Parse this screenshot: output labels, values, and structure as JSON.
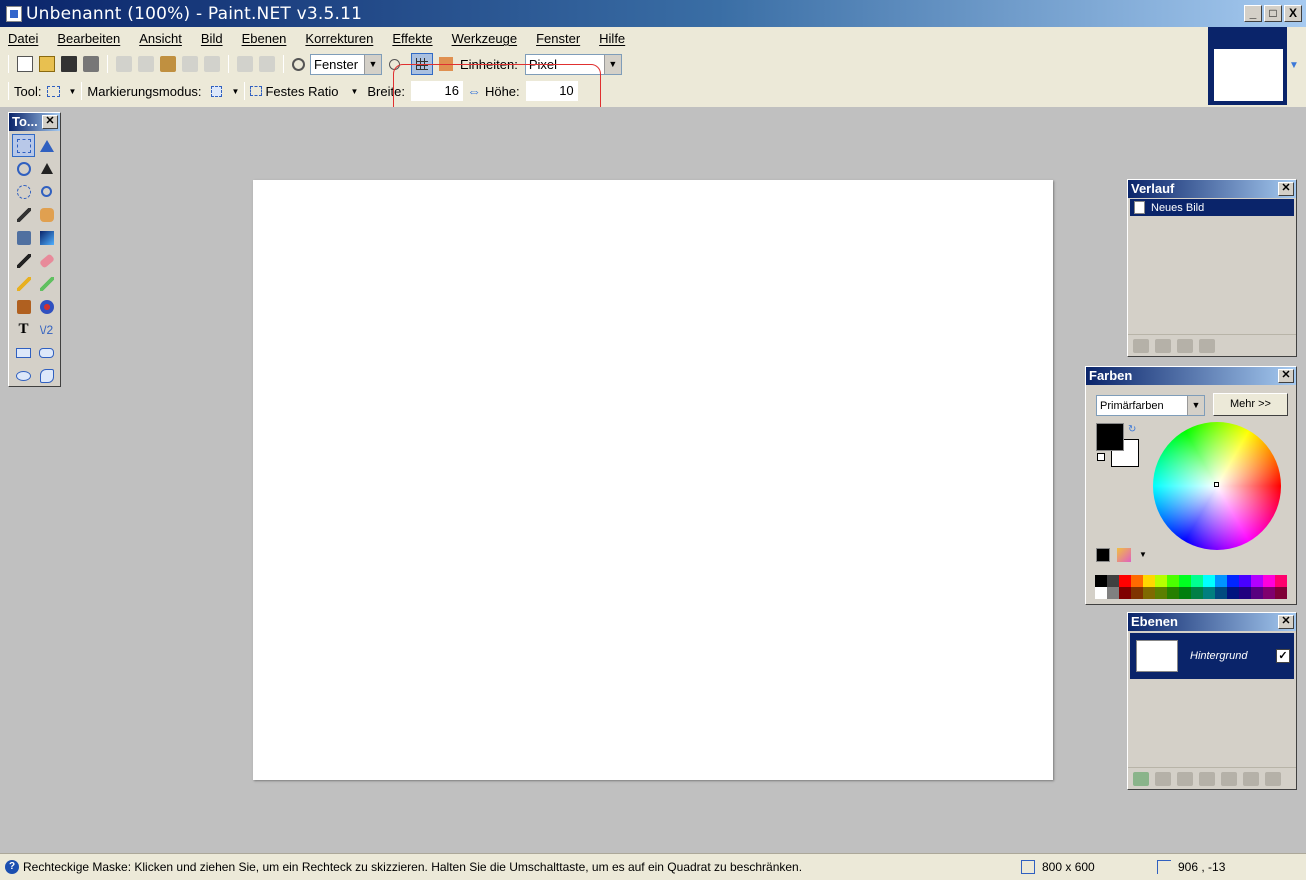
{
  "window": {
    "title": "Unbenannt (100%) - Paint.NET v3.5.11",
    "controls": [
      "_",
      "□",
      "X"
    ]
  },
  "menu": [
    "Datei",
    "Bearbeiten",
    "Ansicht",
    "Bild",
    "Ebenen",
    "Korrekturen",
    "Effekte",
    "Werkzeuge",
    "Fenster",
    "Hilfe"
  ],
  "toolbar": {
    "zoom_value": "Fenster",
    "units_label": "Einheiten:",
    "units_value": "Pixel"
  },
  "tool_options": {
    "tool_label": "Tool:",
    "selection_mode_label": "Markierungsmodus:",
    "ratio_label": "Festes Ratio",
    "width_label": "Breite:",
    "width_value": "16",
    "height_label": "Höhe:",
    "height_value": "10"
  },
  "tools_panel": {
    "title": "To...",
    "tools": [
      "rectangle-select",
      "move-selection",
      "lasso-select",
      "move-selected",
      "ellipse-select",
      "zoom",
      "magic-wand",
      "pan",
      "paint-bucket",
      "gradient",
      "paintbrush",
      "eraser",
      "pencil",
      "color-picker",
      "clone-stamp",
      "recolor",
      "text",
      "line-curve",
      "rectangle",
      "rounded-rectangle",
      "ellipse",
      "freeform-shape"
    ]
  },
  "history_panel": {
    "title": "Verlauf",
    "items": [
      "Neues Bild"
    ]
  },
  "colors_panel": {
    "title": "Farben",
    "mode": "Primärfarben",
    "more_button": "Mehr >>",
    "primary_color": "#000000",
    "secondary_color": "#ffffff",
    "palette_top": [
      "#000000",
      "#404040",
      "#ff0000",
      "#ff6a00",
      "#ffd800",
      "#b6ff00",
      "#4cff00",
      "#00ff21",
      "#00ff90",
      "#00ffff",
      "#0094ff",
      "#0026ff",
      "#4800ff",
      "#b200ff",
      "#ff00dc",
      "#ff006e"
    ],
    "palette_bottom": [
      "#ffffff",
      "#808080",
      "#7f0000",
      "#7f3300",
      "#7f6a00",
      "#5b7f00",
      "#267f00",
      "#007f0e",
      "#007f46",
      "#007f7f",
      "#004a7f",
      "#00137f",
      "#21007f",
      "#57007f",
      "#7f006e",
      "#7f0037"
    ]
  },
  "layers_panel": {
    "title": "Ebenen",
    "layers": [
      {
        "name": "Hintergrund",
        "visible": true
      }
    ]
  },
  "status": {
    "hint": "Rechteckige Maske: Klicken und ziehen Sie, um ein Rechteck zu skizzieren. Halten Sie die Umschalttaste, um es auf ein Quadrat zu beschränken.",
    "image_size": "800 x 600",
    "cursor_position": "906 , -13"
  }
}
